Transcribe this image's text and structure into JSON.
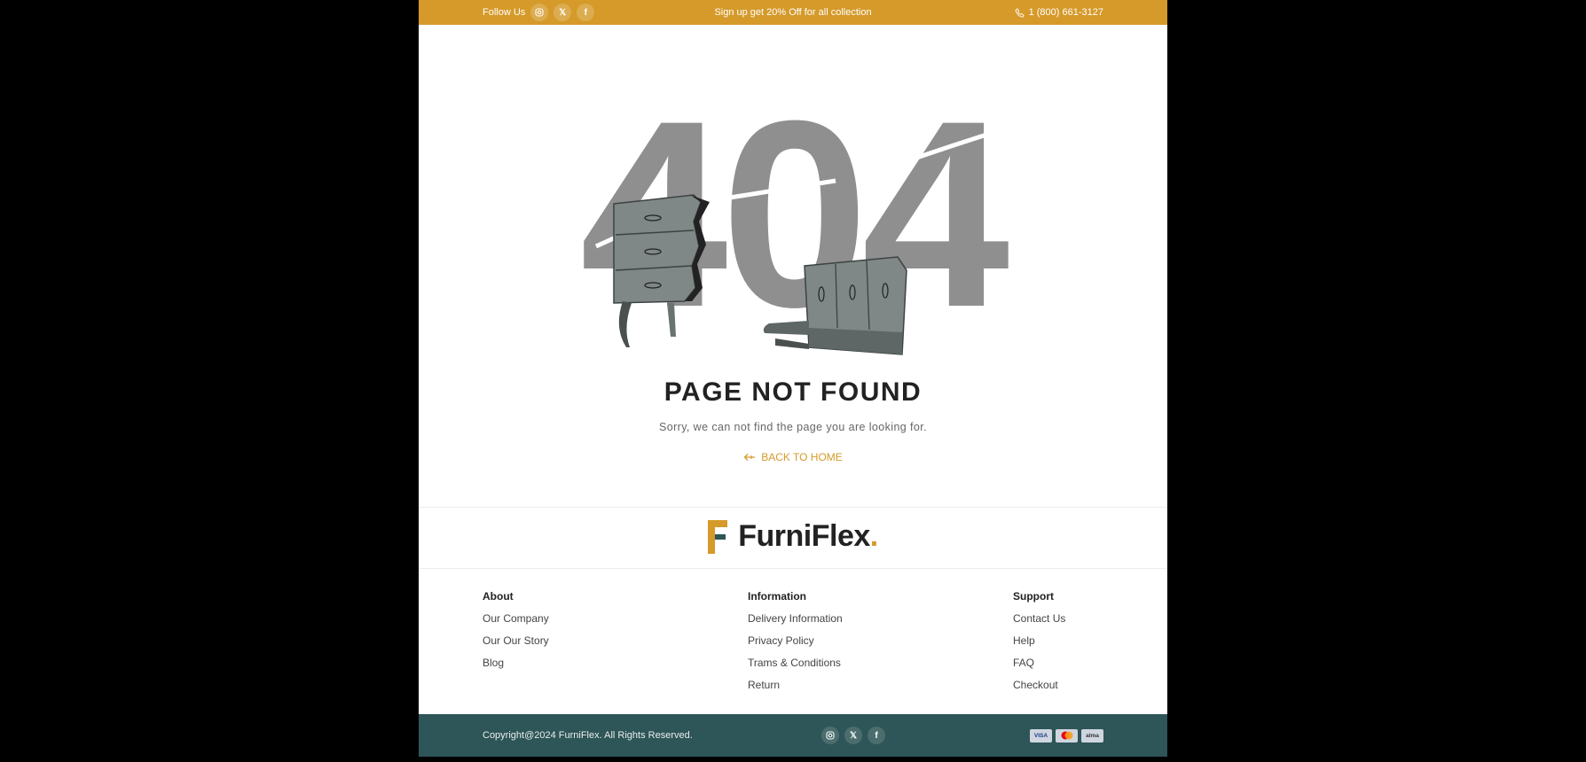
{
  "topbar": {
    "follow_label": "Follow Us",
    "socials": [
      "instagram-icon",
      "x-icon",
      "facebook-icon"
    ],
    "promo": "Sign up get 20% Off for all collection",
    "phone": "1 (800) 661-3127"
  },
  "hero": {
    "code": "404",
    "title": "PAGE NOT FOUND",
    "subtitle": "Sorry, we can not find the page you are looking for.",
    "back_label": "BACK TO HOME"
  },
  "logo": {
    "text": "FurniFlex",
    "dot": "."
  },
  "footer": {
    "columns": [
      {
        "heading": "About",
        "links": [
          "Our Company",
          "Our Our Story",
          "Blog"
        ]
      },
      {
        "heading": "Information",
        "links": [
          "Delivery Information",
          "Privacy Policy",
          "Trams & Conditions",
          "Return"
        ]
      },
      {
        "heading": "Support",
        "links": [
          "Contact Us",
          "Help",
          "FAQ",
          "Checkout"
        ]
      }
    ],
    "copyright": "Copyright@2024 FurniFlex. All Rights Reserved.",
    "payments": [
      "VISA",
      "mastercard",
      "alma"
    ]
  },
  "colors": {
    "accent": "#d59a2a",
    "footer_bar": "#2e5557",
    "text_dark": "#222222",
    "digits": "#8f8f8f"
  }
}
